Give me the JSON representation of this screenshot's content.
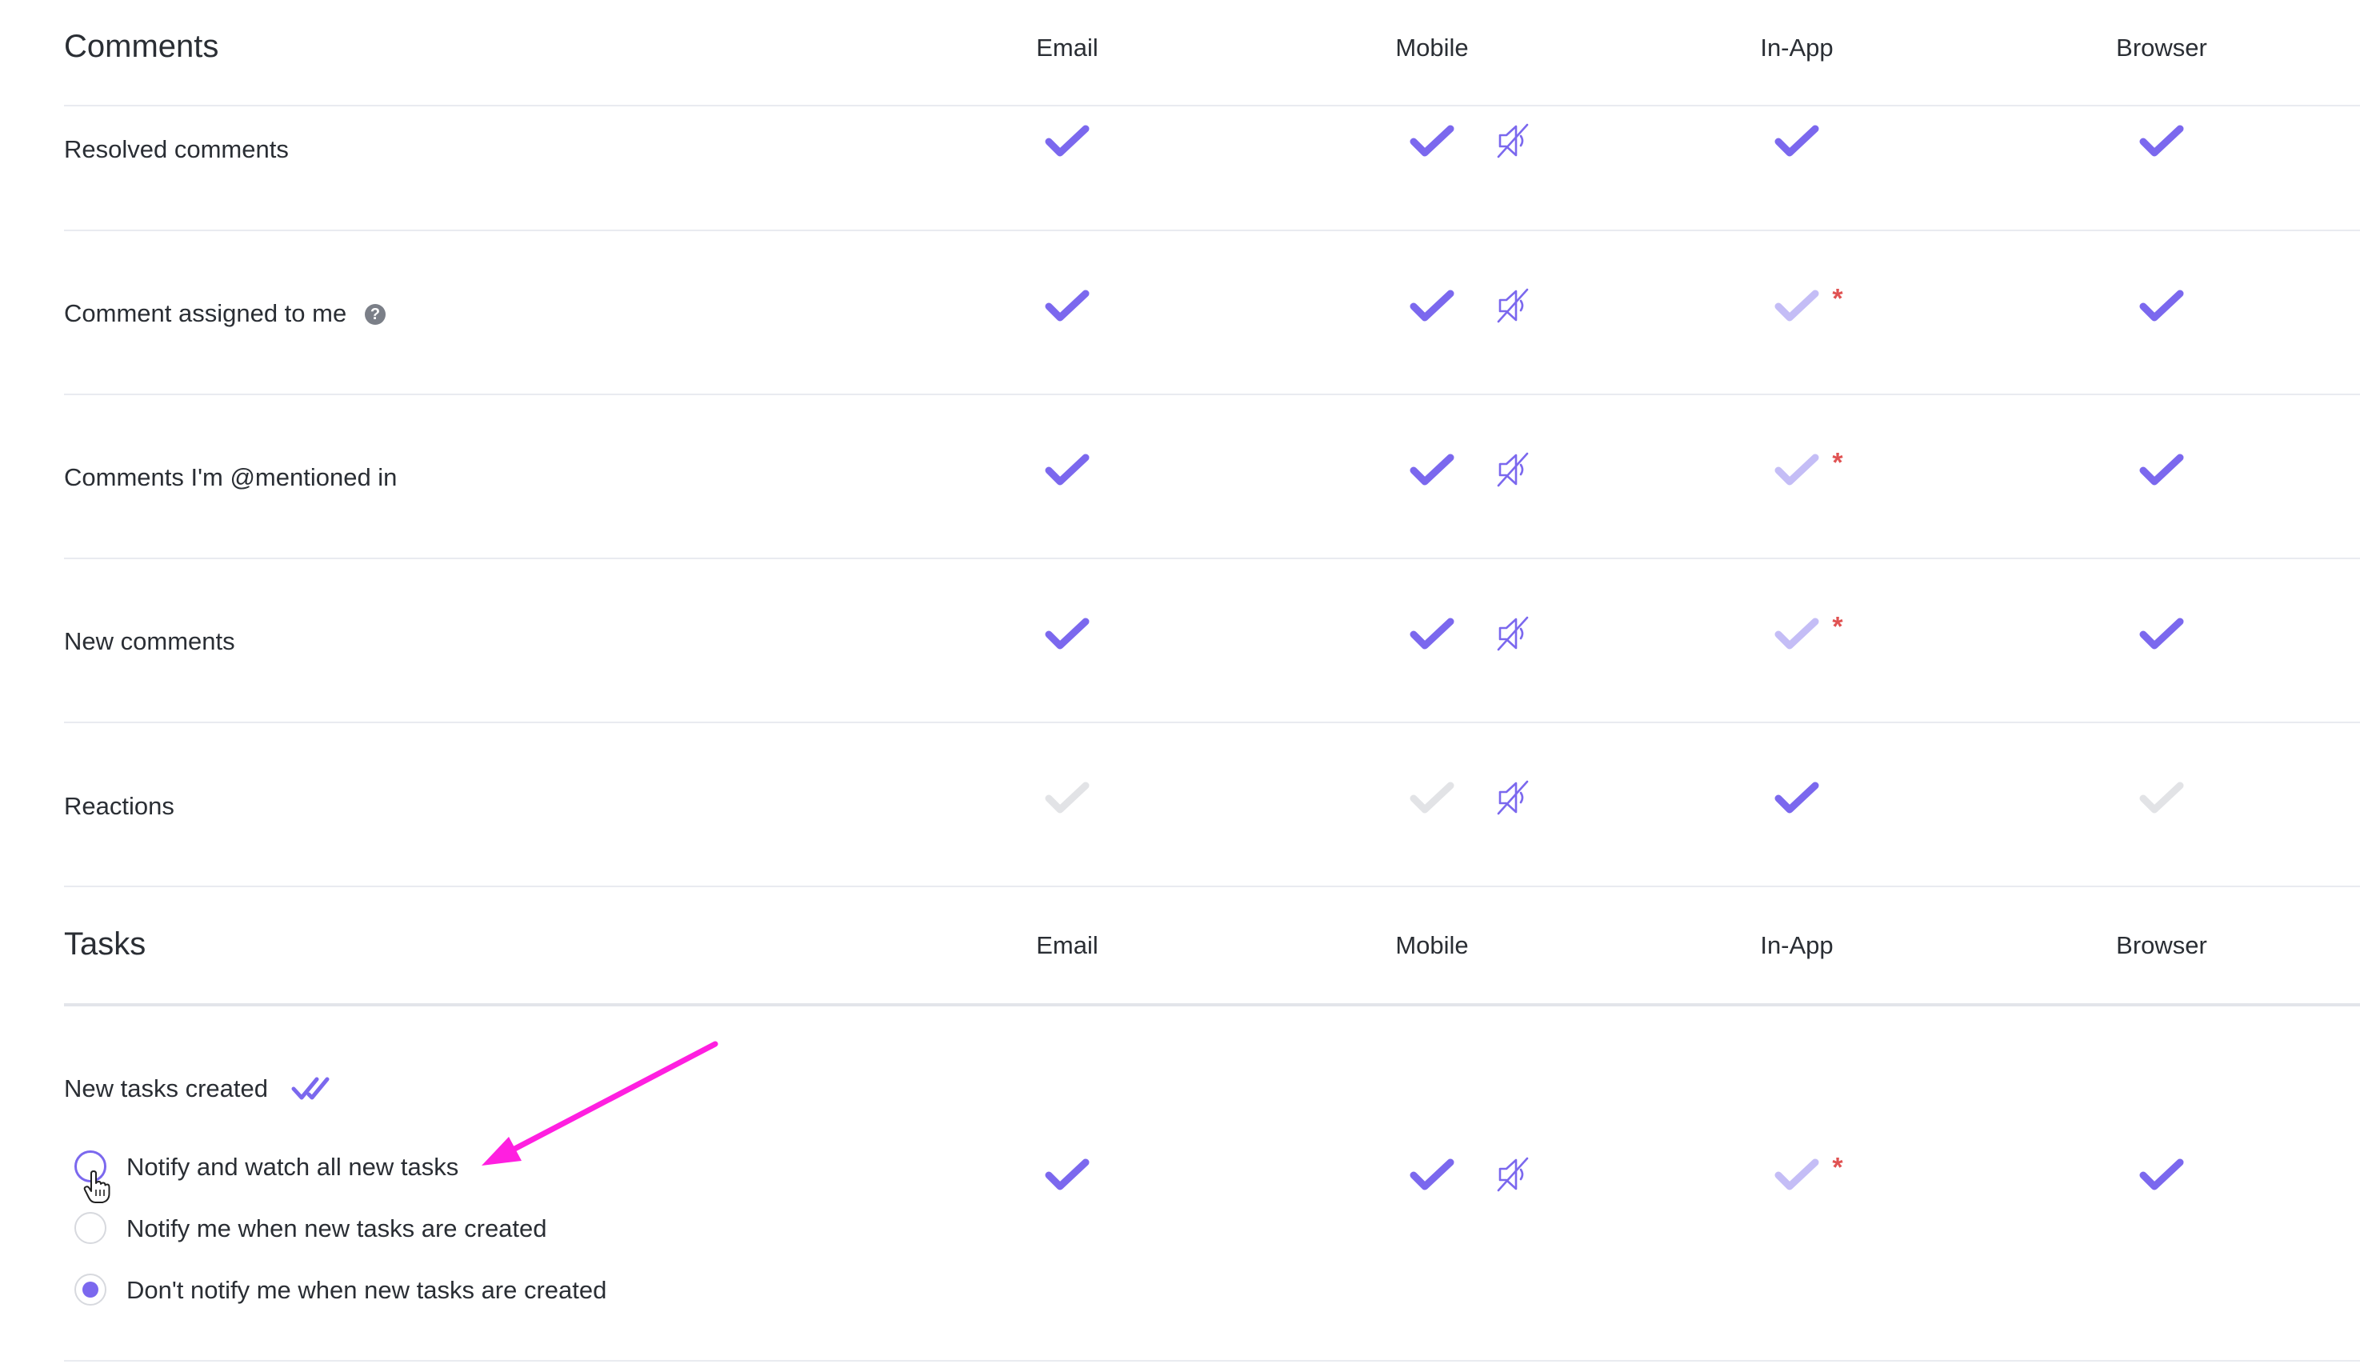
{
  "colors": {
    "accent": "#7b68ee",
    "accent_faded": "#c4bdf6",
    "disabled": "#e2e3e6",
    "required_star": "#e05252",
    "annotation_arrow": "#ff1fe0"
  },
  "columns": [
    "Email",
    "Mobile",
    "In-App",
    "Browser"
  ],
  "comments": {
    "title": "Comments",
    "rows": [
      {
        "label": "Resolved comments",
        "email": "on",
        "mobile": "on",
        "inapp": "on",
        "browser": "on",
        "inapp_required": false,
        "help": false
      },
      {
        "label": "Comment assigned to me",
        "email": "on",
        "mobile": "on",
        "inapp": "faded",
        "browser": "on",
        "inapp_required": true,
        "help": true
      },
      {
        "label": "Comments I'm @mentioned in",
        "email": "on",
        "mobile": "on",
        "inapp": "faded",
        "browser": "on",
        "inapp_required": true,
        "help": false
      },
      {
        "label": "New comments",
        "email": "on",
        "mobile": "on",
        "inapp": "faded",
        "browser": "on",
        "inapp_required": true,
        "help": false
      },
      {
        "label": "Reactions",
        "email": "off",
        "mobile": "off",
        "inapp": "on",
        "browser": "off",
        "inapp_required": false,
        "help": false
      }
    ]
  },
  "tasks": {
    "title": "Tasks",
    "rows": [
      {
        "label": "New tasks created",
        "email": "on",
        "mobile": "on",
        "inapp": "faded",
        "browser": "on",
        "inapp_required": true,
        "icon": "double-check-icon",
        "options": [
          {
            "label": "Notify and watch all new tasks",
            "state": "hover"
          },
          {
            "label": "Notify me when new tasks are created",
            "state": "unchecked"
          },
          {
            "label": "Don't notify me when new tasks are created",
            "state": "checked"
          }
        ]
      }
    ]
  },
  "icons": {
    "check": "check-icon",
    "mute": "muted-speaker-icon",
    "help": "question-circle-icon",
    "help_glyph": "?",
    "required_glyph": "*",
    "cursor": "hand-pointer-cursor"
  }
}
